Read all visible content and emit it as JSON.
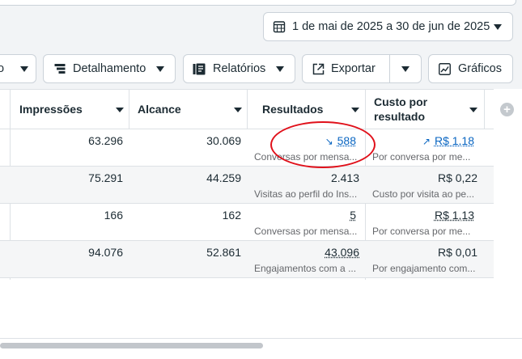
{
  "date_range": {
    "label": "1 de mai de 2025 a 30 de jun de 2025"
  },
  "toolbar": {
    "partial_label": "o",
    "breakdown_label": "Detalhamento",
    "reports_label": "Relatórios",
    "export_label": "Exportar",
    "charts_label": "Gráficos"
  },
  "table": {
    "headers": {
      "impressions": "Impressões",
      "reach": "Alcance",
      "results": "Resultados",
      "cost_line1": "Custo por",
      "cost_line2": "resultado"
    },
    "rows": [
      {
        "impressions": "63.296",
        "reach": "30.069",
        "results": "588",
        "results_sub": "Conversas por mensa...",
        "cost": "R$ 1,18",
        "cost_sub": "Por conversa por me..."
      },
      {
        "impressions": "75.291",
        "reach": "44.259",
        "results": "2.413",
        "results_sub": "Visitas ao perfil do Ins...",
        "cost": "R$ 0,22",
        "cost_sub": "Custo por visita ao pe..."
      },
      {
        "impressions": "166",
        "reach": "162",
        "results": "5",
        "results_sub": "Conversas por mensa...",
        "cost": "R$ 1,13",
        "cost_sub": "Por conversa por me..."
      },
      {
        "impressions": "94.076",
        "reach": "52.861",
        "results": "43.096",
        "results_sub": "Engajamentos com a ...",
        "cost": "R$ 0,01",
        "cost_sub": "Por engajamento com..."
      }
    ]
  },
  "colors": {
    "annotation": "#e0101a",
    "link": "#0a66c2"
  }
}
